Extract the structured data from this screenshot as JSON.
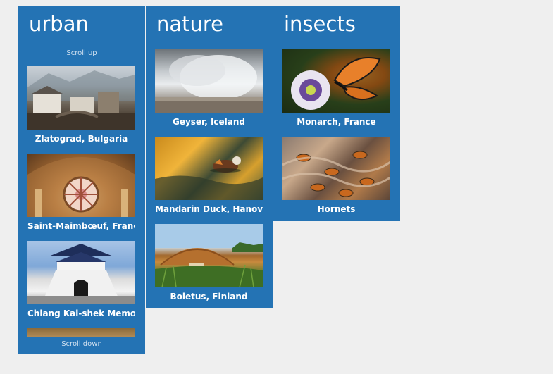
{
  "columns": {
    "urban": {
      "title": "urban",
      "scroll_up": "Scroll up",
      "scroll_down": "Scroll down",
      "tiles": [
        {
          "caption": "Zlatograd, Bulgaria"
        },
        {
          "caption": "Saint-Maimbœuf, France"
        },
        {
          "caption": "Chiang Kai-shek Memorial"
        },
        {
          "caption": ""
        }
      ]
    },
    "nature": {
      "title": "nature",
      "tiles": [
        {
          "caption": "Geyser, Iceland"
        },
        {
          "caption": "Mandarin Duck, Hanover"
        },
        {
          "caption": "Boletus, Finland"
        }
      ]
    },
    "insects": {
      "title": "insects",
      "tiles": [
        {
          "caption": "Monarch, France"
        },
        {
          "caption": "Hornets"
        }
      ]
    }
  },
  "colors": {
    "background": "#efefef",
    "column": "#2473b4",
    "text": "#ffffff"
  }
}
